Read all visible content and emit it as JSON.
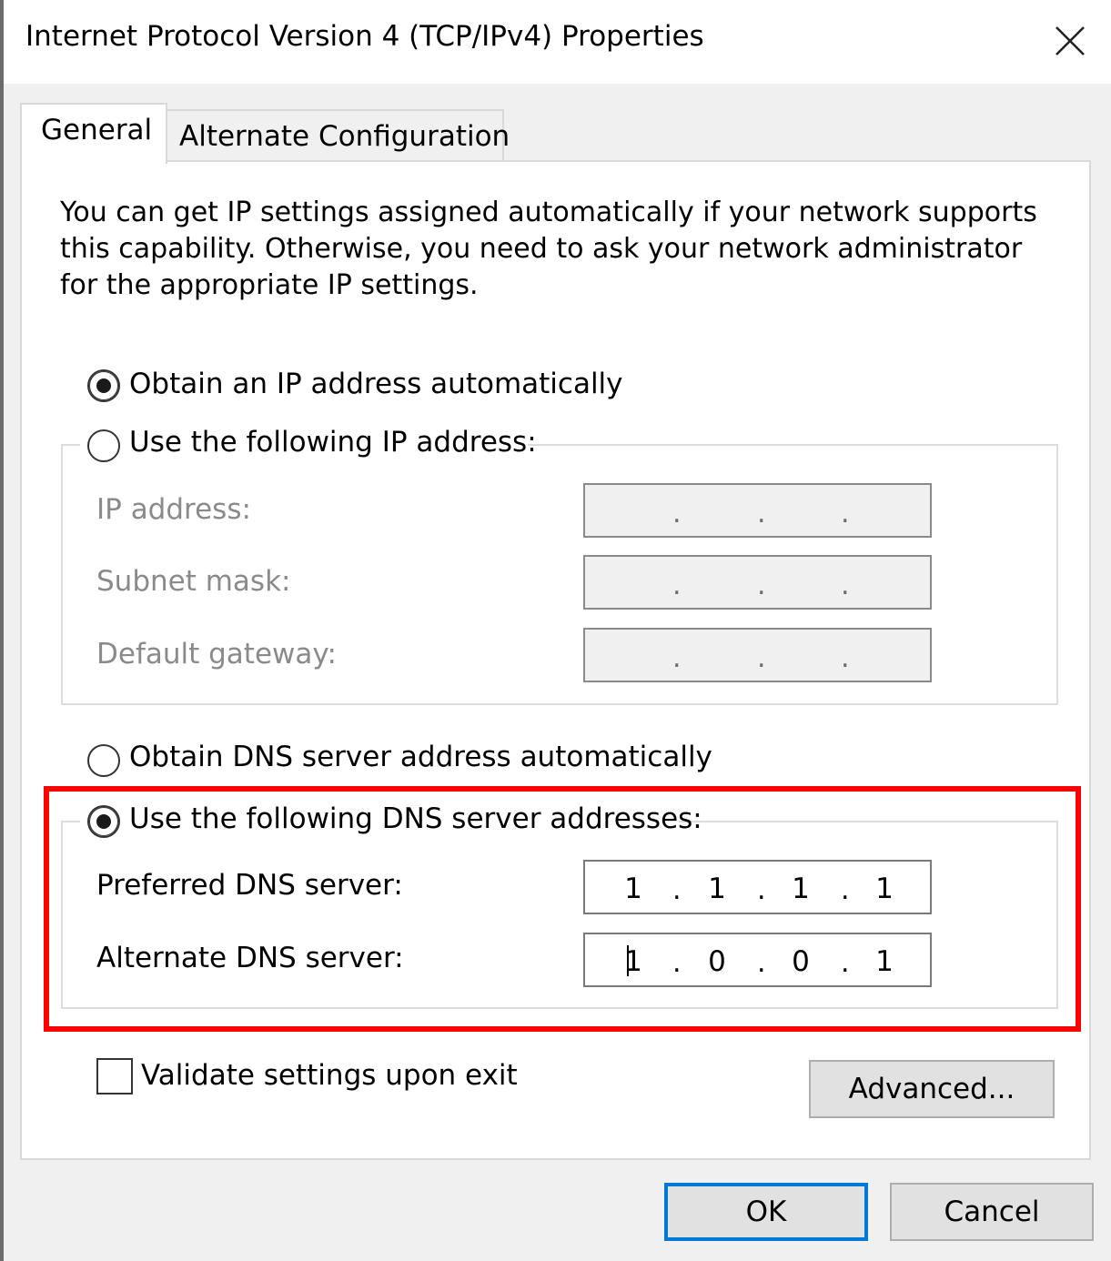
{
  "window": {
    "title": "Internet Protocol Version 4 (TCP/IPv4) Properties",
    "close_icon": "close-icon"
  },
  "tabs": [
    {
      "label": "General",
      "selected": true
    },
    {
      "label": "Alternate Configuration",
      "selected": false
    }
  ],
  "intro_text": "You can get IP settings assigned automatically if your network supports this capability. Otherwise, you need to ask your network administrator for the appropriate IP settings.",
  "ip_section": {
    "obtain_auto_label": "Obtain an IP address automatically",
    "obtain_auto_checked": true,
    "use_following_label": "Use the following IP address:",
    "use_following_checked": false,
    "fields": [
      {
        "label": "IP address:",
        "value": "",
        "enabled": false
      },
      {
        "label": "Subnet mask:",
        "value": "",
        "enabled": false
      },
      {
        "label": "Default gateway:",
        "value": "",
        "enabled": false
      }
    ]
  },
  "dns_section": {
    "obtain_auto_label": "Obtain DNS server address automatically",
    "obtain_auto_checked": false,
    "use_following_label": "Use the following DNS server addresses:",
    "use_following_checked": true,
    "preferred": {
      "label": "Preferred DNS server:",
      "octets": [
        "1",
        "1",
        "1",
        "1"
      ]
    },
    "alternate": {
      "label": "Alternate DNS server:",
      "octets": [
        "1",
        "0",
        "0",
        "1"
      ]
    }
  },
  "validate": {
    "label": "Validate settings upon exit",
    "checked": false
  },
  "buttons": {
    "advanced": "Advanced...",
    "ok": "OK",
    "cancel": "Cancel"
  },
  "colors": {
    "highlight": "#ff0000",
    "default_button_border": "#0078d7"
  }
}
